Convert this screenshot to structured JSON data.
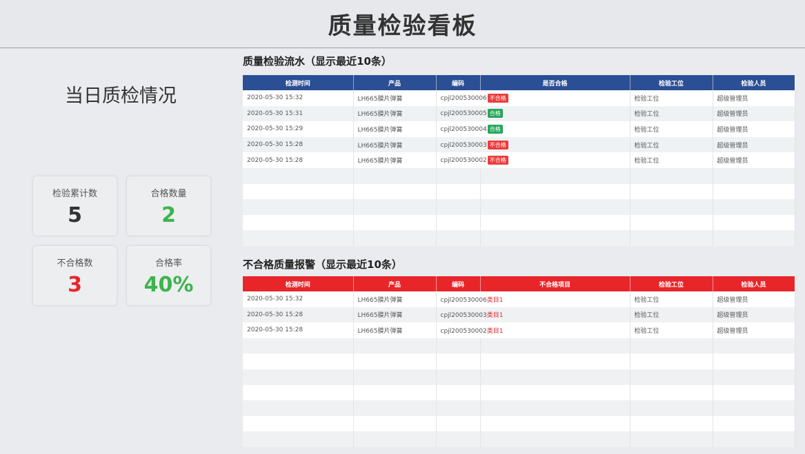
{
  "header": {
    "title": "质量检验看板"
  },
  "summary": {
    "title": "当日质检情况",
    "cards": [
      {
        "label": "检验累计数",
        "value": "5",
        "color": "#333333"
      },
      {
        "label": "合格数量",
        "value": "2",
        "color": "#3cb44b"
      },
      {
        "label": "不合格数",
        "value": "3",
        "color": "#e8262a"
      },
      {
        "label": "合格率",
        "value": "40%",
        "color": "#3cb44b"
      }
    ]
  },
  "flow": {
    "title": "质量检验流水（显示最近10条）",
    "columns": [
      "检测时间",
      "产品",
      "编码",
      "是否合格",
      "检验工位",
      "检验人员"
    ],
    "rows": [
      {
        "time": "2020-05-30 15:32",
        "product": "LH665膜片弹簧",
        "code": "cpjl200530006",
        "result": "不合格",
        "result_type": "fail",
        "station": "检验工位",
        "person": "超级管理员"
      },
      {
        "time": "2020-05-30 15:31",
        "product": "LH665膜片弹簧",
        "code": "cpjl200530005",
        "result": "合格",
        "result_type": "pass",
        "station": "检验工位",
        "person": "超级管理员"
      },
      {
        "time": "2020-05-30 15:29",
        "product": "LH665膜片弹簧",
        "code": "cpjl200530004",
        "result": "合格",
        "result_type": "pass",
        "station": "检验工位",
        "person": "超级管理员"
      },
      {
        "time": "2020-05-30 15:28",
        "product": "LH665膜片弹簧",
        "code": "cpjl200530003",
        "result": "不合格",
        "result_type": "fail",
        "station": "检验工位",
        "person": "超级管理员"
      },
      {
        "time": "2020-05-30 15:28",
        "product": "LH665膜片弹簧",
        "code": "cpjl200530002",
        "result": "不合格",
        "result_type": "fail",
        "station": "检验工位",
        "person": "超级管理员"
      }
    ]
  },
  "alarm": {
    "title": "不合格质量报警（显示最近10条）",
    "columns": [
      "检测时间",
      "产品",
      "编码",
      "不合格项目",
      "检验工位",
      "检验人员"
    ],
    "rows": [
      {
        "time": "2020-05-30 15:32",
        "product": "LH665膜片弹簧",
        "code": "cpjl200530006",
        "item": "类目1",
        "station": "检验工位",
        "person": "超级管理员"
      },
      {
        "time": "2020-05-30 15:28",
        "product": "LH665膜片弹簧",
        "code": "cpjl200530003",
        "item": "类目1",
        "station": "检验工位",
        "person": "超级管理员"
      },
      {
        "time": "2020-05-30 15:28",
        "product": "LH665膜片弹簧",
        "code": "cpjl200530002",
        "item": "类目1",
        "station": "检验工位",
        "person": "超级管理员"
      }
    ]
  },
  "colors": {
    "flow_header": "#2b4f94",
    "alarm_header": "#e8262a",
    "pass": "#26a65b",
    "fail": "#ee3b3b"
  }
}
